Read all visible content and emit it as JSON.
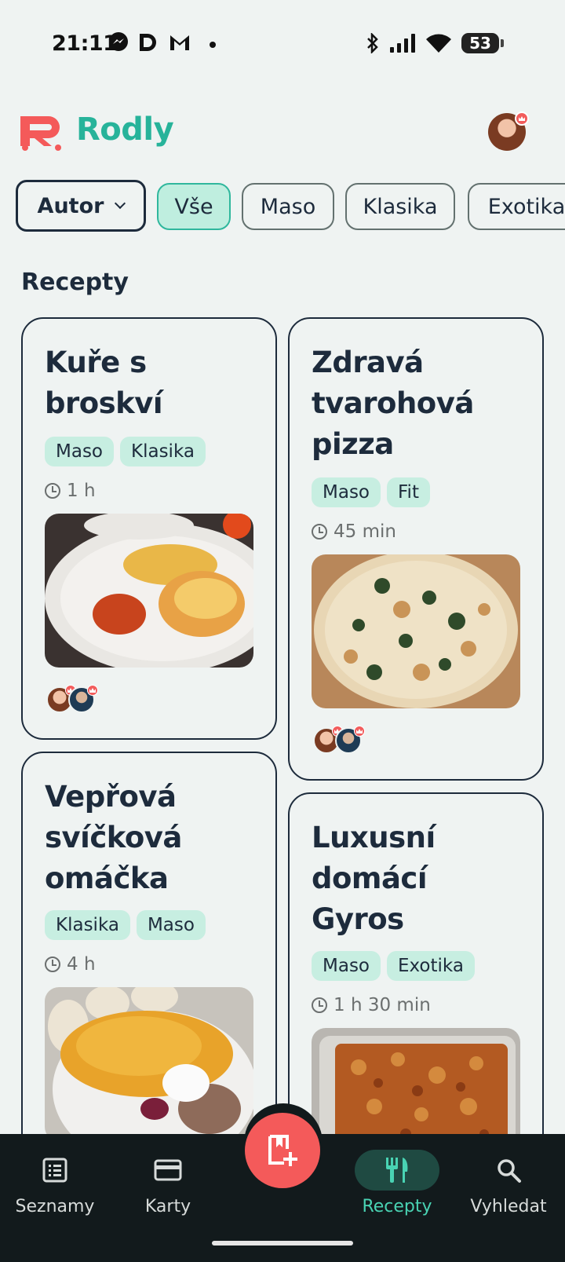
{
  "status": {
    "time": "21:11",
    "battery": "53"
  },
  "app": {
    "title": "Rodly"
  },
  "filters": {
    "author_label": "Autor",
    "chips": [
      "Vše",
      "Maso",
      "Klasika",
      "Exotika"
    ]
  },
  "section_title": "Recepty",
  "recipes": [
    {
      "title": "Kuře s broskví",
      "tags": [
        "Maso",
        "Klasika"
      ],
      "time": "1 h"
    },
    {
      "title": "Zdravá tvarohová pizza",
      "tags": [
        "Maso",
        "Fit"
      ],
      "time": "45 min"
    },
    {
      "title": "Vepřová svíčková omáčka",
      "tags": [
        "Klasika",
        "Maso"
      ],
      "time": "4 h"
    },
    {
      "title": "Luxusní domácí Gyros",
      "tags": [
        "Maso",
        "Exotika"
      ],
      "time": "1 h 30 min"
    }
  ],
  "nav": {
    "items": [
      {
        "label": "Seznamy",
        "icon": "list-icon"
      },
      {
        "label": "Karty",
        "icon": "card-icon"
      },
      {
        "label": "Recepty",
        "icon": "utensils-icon"
      },
      {
        "label": "Vyhledat",
        "icon": "search-icon"
      }
    ],
    "fab_icon": "add-recipe-icon"
  },
  "colors": {
    "accent": "#27b39a",
    "brand_red": "#f45a5a",
    "nav_bg": "#121a1c",
    "chip_active": "#bfeedf"
  }
}
